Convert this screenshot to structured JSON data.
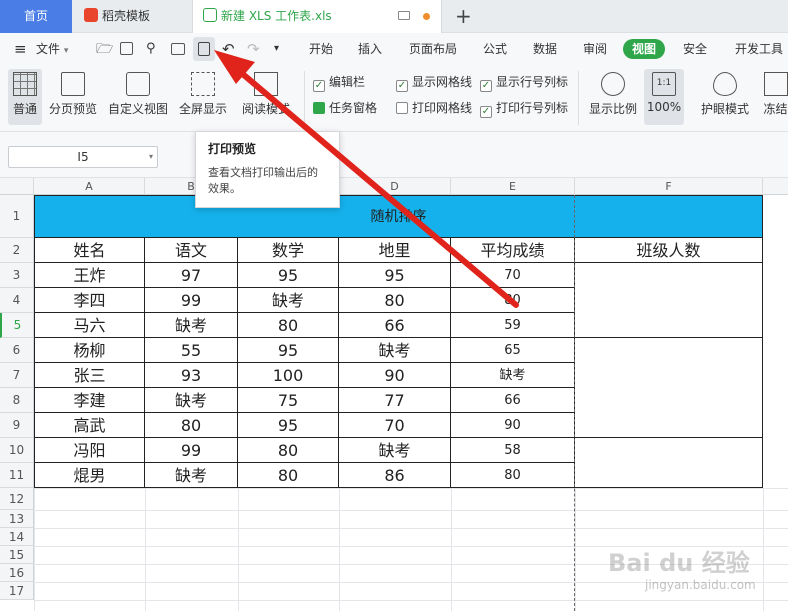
{
  "tabs": {
    "home": "首页",
    "template": "稻壳模板",
    "file": "新建 XLS 工作表.xls",
    "add": "+"
  },
  "menu": {
    "file": "文件",
    "items": [
      "开始",
      "插入",
      "页面布局",
      "公式",
      "数据",
      "审阅",
      "视图",
      "安全",
      "开发工具"
    ]
  },
  "ribbon": {
    "normal": "普通",
    "page_break": "分页预览",
    "custom_view": "自定义视图",
    "fullscreen": "全屏显示",
    "reading_mode": "阅读模式",
    "edit_bar": "编辑栏",
    "task_pane": "任务窗格",
    "show_grid": "显示网格线",
    "print_grid": "打印网格线",
    "show_rowcol": "显示行号列标",
    "print_rowcol": "打印行号列标",
    "zoom": "显示比例",
    "zoom_100": "100%",
    "eye_mode": "护眼模式",
    "freeze": "冻结"
  },
  "namebox": "I5",
  "tooltip": {
    "title": "打印预览",
    "desc": "查看文档打印输出后的效果。"
  },
  "columns": [
    "A",
    "B",
    "C",
    "D",
    "E",
    "F"
  ],
  "rows": [
    "1",
    "2",
    "3",
    "4",
    "5",
    "6",
    "7",
    "8",
    "9",
    "10",
    "11",
    "12",
    "13",
    "14",
    "15",
    "16",
    "17"
  ],
  "sheet": {
    "title": "随机排序",
    "headers": [
      "姓名",
      "语文",
      "数学",
      "地里",
      "平均成绩",
      "班级人数"
    ],
    "data": [
      [
        "王炸",
        "97",
        "95",
        "95",
        "70"
      ],
      [
        "李四",
        "99",
        "缺考",
        "80",
        "80"
      ],
      [
        "马六",
        "缺考",
        "80",
        "66",
        "59"
      ],
      [
        "杨柳",
        "55",
        "95",
        "缺考",
        "65"
      ],
      [
        "张三",
        "93",
        "100",
        "90",
        "缺考"
      ],
      [
        "李建",
        "缺考",
        "75",
        "77",
        "66"
      ],
      [
        "高武",
        "80",
        "95",
        "70",
        "90"
      ],
      [
        "冯阳",
        "99",
        "80",
        "缺考",
        "58"
      ],
      [
        "焜男",
        "缺考",
        "80",
        "86",
        "80"
      ]
    ]
  },
  "watermark": {
    "brand": "Bai du 经验",
    "url": "jingyan.baidu.com"
  },
  "colors": {
    "title_fill": "#15b1ec",
    "active_tab": "#2fa64a",
    "home_tab": "#4a7ee6",
    "arrow": "#e0241b"
  }
}
